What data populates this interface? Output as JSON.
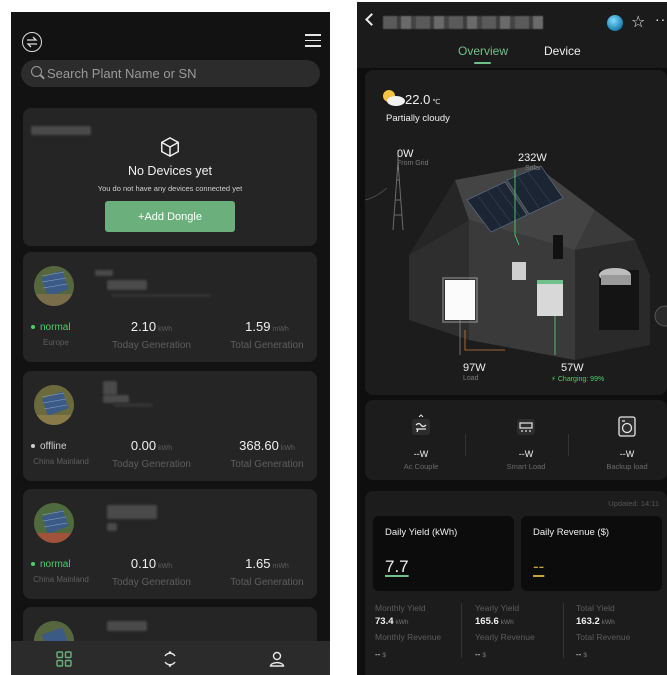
{
  "left": {
    "search_placeholder": "Search Plant Name or SN",
    "no_devices": {
      "title": "No Devices yet",
      "subtitle": "You do not have any devices connected yet",
      "button": "+Add Dongle"
    },
    "plants": [
      {
        "status": "normal",
        "status_color": "#4ccf6a",
        "region": "Europe",
        "today_value": "2.10",
        "today_unit": "kWh",
        "today_label": "Today Generation",
        "total_value": "1.59",
        "total_unit": "mWh",
        "total_label": "Total Generation"
      },
      {
        "status": "offline",
        "status_color": "#cfcfcf",
        "region": "China Mainland",
        "today_value": "0.00",
        "today_unit": "kWh",
        "today_label": "Today Generation",
        "total_value": "368.60",
        "total_unit": "kWh",
        "total_label": "Total Generation"
      },
      {
        "status": "normal",
        "status_color": "#4ccf6a",
        "region": "China Mainland",
        "today_value": "0.10",
        "today_unit": "kWh",
        "today_label": "Today Generation",
        "total_value": "1.65",
        "total_unit": "mWh",
        "total_label": "Total Generation"
      }
    ],
    "nav": [
      "grid-icon",
      "refresh-icon",
      "user-icon"
    ]
  },
  "right": {
    "tabs": {
      "overview": "Overview",
      "device": "Device"
    },
    "weather": {
      "temp": "22.0",
      "unit": "℃",
      "condition": "Partially cloudy"
    },
    "flows": {
      "grid": {
        "value": "0W",
        "label": "From Grid"
      },
      "solar": {
        "value": "232W",
        "label": "Solar"
      },
      "load": {
        "value": "97W",
        "label": "Load"
      },
      "battery": {
        "value": "57W",
        "label": "Charging: 99%"
      }
    },
    "loads": [
      {
        "value": "--W",
        "name": "Ac Couple"
      },
      {
        "value": "--W",
        "name": "Smart Load"
      },
      {
        "value": "--W",
        "name": "Backup load"
      }
    ],
    "updated": "Updated: 14:11",
    "daily_yield": {
      "label": "Daily Yield (kWh)",
      "value": "7.7"
    },
    "daily_revenue": {
      "label": "Daily Revenue ($)",
      "value": "--"
    },
    "stats": [
      {
        "k1": "Monthly Yield",
        "v1": "73.4",
        "u1": "kWh",
        "k2": "Monthly Revenue",
        "v2": "--",
        "u2": "$"
      },
      {
        "k1": "Yearly Yield",
        "v1": "165.6",
        "u1": "kWh",
        "k2": "Yearly Revenue",
        "v2": "--",
        "u2": "$"
      },
      {
        "k1": "Total Yield",
        "v1": "163.2",
        "u1": "kWh",
        "k2": "Total Revenue",
        "v2": "--",
        "u2": "$"
      }
    ]
  }
}
